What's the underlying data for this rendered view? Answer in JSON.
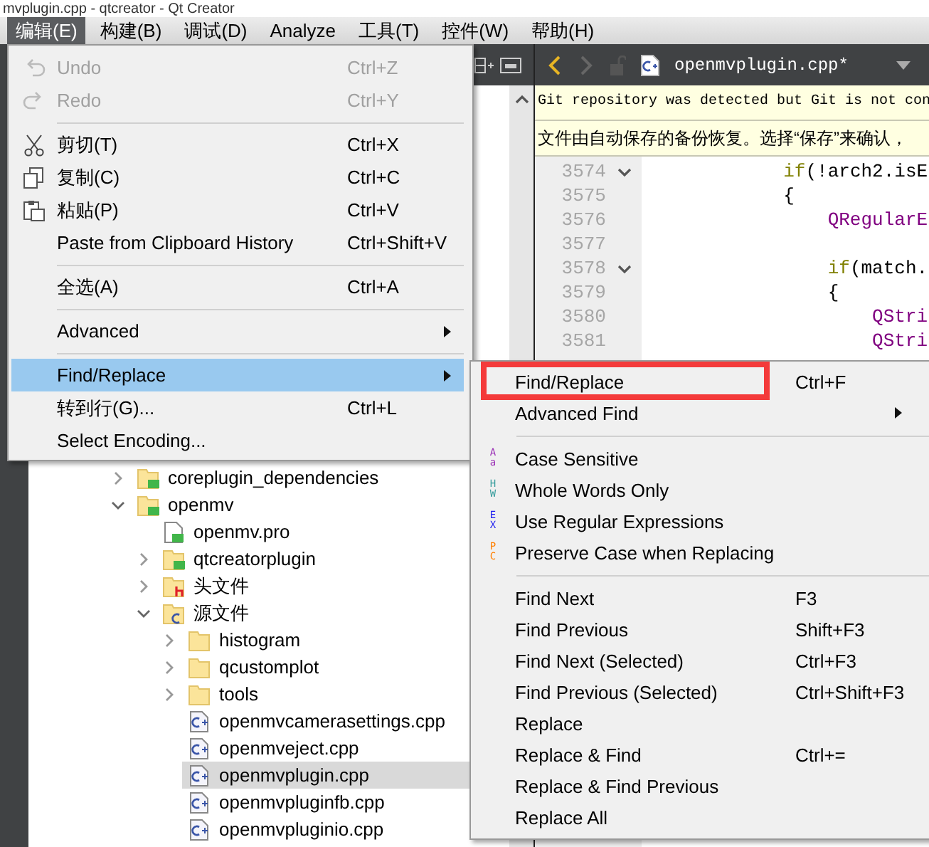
{
  "window": {
    "title": "mvplugin.cpp - qtcreator - Qt Creator"
  },
  "menubar": [
    {
      "label": "编辑(E)",
      "selected": true
    },
    {
      "label": "构建(B)",
      "selected": false
    },
    {
      "label": "调试(D)",
      "selected": false
    },
    {
      "label": "Analyze",
      "selected": false
    },
    {
      "label": "工具(T)",
      "selected": false
    },
    {
      "label": "控件(W)",
      "selected": false
    },
    {
      "label": "帮助(H)",
      "selected": false
    }
  ],
  "project_tree": [
    {
      "label": "coreplugin_dependencies",
      "kind": "qtfolder",
      "expanded": false,
      "selected": false
    },
    {
      "label": "openmv",
      "kind": "qtfolder",
      "expanded": true,
      "selected": false,
      "children": [
        {
          "label": "openmv.pro",
          "kind": "qtfile",
          "selected": false
        },
        {
          "label": "qtcreatorplugin",
          "kind": "qtfolder",
          "expanded": false,
          "selected": false
        },
        {
          "label": "头文件",
          "kind": "headers",
          "expanded": false,
          "selected": false
        },
        {
          "label": "源文件",
          "kind": "sources",
          "expanded": true,
          "selected": false,
          "children": [
            {
              "label": "histogram",
              "kind": "folder",
              "expanded": false,
              "selected": false
            },
            {
              "label": "qcustomplot",
              "kind": "folder",
              "expanded": false,
              "selected": false
            },
            {
              "label": "tools",
              "kind": "folder",
              "expanded": false,
              "selected": false
            },
            {
              "label": "openmvcamerasettings.cpp",
              "kind": "cpp",
              "selected": false
            },
            {
              "label": "openmveject.cpp",
              "kind": "cpp",
              "selected": false
            },
            {
              "label": "openmvplugin.cpp",
              "kind": "cpp",
              "selected": true
            },
            {
              "label": "openmvpluginfb.cpp",
              "kind": "cpp",
              "selected": false
            },
            {
              "label": "openmvpluginio.cpp",
              "kind": "cpp",
              "selected": false
            }
          ]
        }
      ]
    }
  ],
  "editor": {
    "back_enabled": true,
    "forward_enabled": false,
    "file_name": "openmvplugin.cpp*",
    "info_bars": [
      {
        "text": "Git repository was detected but Git is not con",
        "kind": "mono"
      },
      {
        "text": "文件由自动保存的备份恢复。选择“保存”来确认，",
        "kind": "plain"
      }
    ],
    "lines": [
      {
        "number": "3574",
        "fold": true,
        "segments": [
          {
            "text": "            if",
            "kind": "keyword"
          },
          {
            "text": "(!arch2.isE",
            "kind": "plain"
          }
        ]
      },
      {
        "number": "3575",
        "fold": false,
        "segments": [
          {
            "text": "            {",
            "kind": "plain"
          }
        ]
      },
      {
        "number": "3576",
        "fold": false,
        "segments": [
          {
            "text": "                QRegularE",
            "kind": "type"
          }
        ]
      },
      {
        "number": "3577",
        "fold": false
      },
      {
        "number": "3578",
        "fold": true,
        "segments": [
          {
            "text": "                if",
            "kind": "keyword"
          },
          {
            "text": "(match.",
            "kind": "plain"
          }
        ]
      },
      {
        "number": "3579",
        "fold": false,
        "segments": [
          {
            "text": "                {",
            "kind": "plain"
          }
        ]
      },
      {
        "number": "3580",
        "fold": false,
        "segments": [
          {
            "text": "                    QStri",
            "kind": "type"
          }
        ]
      },
      {
        "number": "3581",
        "fold": false,
        "segments": [
          {
            "text": "                    QStri",
            "kind": "type"
          }
        ]
      }
    ]
  },
  "edit_menu": {
    "groups": [
      {
        "items": [
          {
            "label": "Undo",
            "kind": "undo",
            "shortcut": "Ctrl+Z",
            "disabled": true,
            "selected": false,
            "submenu": false
          },
          {
            "label": "Redo",
            "kind": "redo",
            "shortcut": "Ctrl+Y",
            "disabled": true,
            "selected": false,
            "submenu": false
          }
        ]
      },
      {
        "items": [
          {
            "label": "剪切(T)",
            "kind": "cut",
            "shortcut": "Ctrl+X",
            "disabled": false,
            "selected": false,
            "submenu": false
          },
          {
            "label": "复制(C)",
            "kind": "copy",
            "shortcut": "Ctrl+C",
            "disabled": false,
            "selected": false,
            "submenu": false
          },
          {
            "label": "粘贴(P)",
            "kind": "paste",
            "shortcut": "Ctrl+V",
            "disabled": false,
            "selected": false,
            "submenu": false
          },
          {
            "label": "Paste from Clipboard History",
            "shortcut": "Ctrl+Shift+V",
            "disabled": false,
            "selected": false,
            "submenu": false
          }
        ]
      },
      {
        "items": [
          {
            "label": "全选(A)",
            "shortcut": "Ctrl+A",
            "disabled": false,
            "selected": false,
            "submenu": false
          }
        ]
      },
      {
        "items": [
          {
            "label": "Advanced",
            "disabled": false,
            "selected": false,
            "submenu": true
          }
        ]
      },
      {
        "items": [
          {
            "label": "Find/Replace",
            "disabled": false,
            "selected": true,
            "submenu": true
          },
          {
            "label": "转到行(G)...",
            "shortcut": "Ctrl+L",
            "disabled": false,
            "selected": false,
            "submenu": false
          },
          {
            "label": "Select Encoding...",
            "disabled": false,
            "selected": false,
            "submenu": false
          }
        ]
      }
    ]
  },
  "find_submenu": {
    "groups": [
      {
        "items": [
          {
            "label": "Find/Replace",
            "shortcut": "Ctrl+F",
            "framed": true,
            "submenu": false
          },
          {
            "label": "Advanced Find",
            "framed": false,
            "submenu": true
          }
        ]
      },
      {
        "items": [
          {
            "label": "Case Sensitive",
            "framed": false,
            "submenu": false,
            "flag": {
              "top": "A",
              "bottom": "a",
              "color": "#9a2fb5"
            }
          },
          {
            "label": "Whole Words Only",
            "framed": false,
            "submenu": false,
            "flag": {
              "top": "H",
              "bottom": "W",
              "color": "#3a9e9e"
            }
          },
          {
            "label": "Use Regular Expressions",
            "framed": false,
            "submenu": false,
            "flag": {
              "top": "E",
              "bottom": "X",
              "color": "#1c1cf0"
            }
          },
          {
            "label": "Preserve Case when Replacing",
            "framed": false,
            "submenu": false,
            "flag": {
              "top": "P",
              "bottom": "C",
              "color": "#ff7f00"
            }
          }
        ]
      },
      {
        "items": [
          {
            "label": "Find Next",
            "shortcut": "F3",
            "framed": false,
            "submenu": false
          },
          {
            "label": "Find Previous",
            "shortcut": "Shift+F3",
            "framed": false,
            "submenu": false
          },
          {
            "label": "Find Next (Selected)",
            "shortcut": "Ctrl+F3",
            "framed": false,
            "submenu": false
          },
          {
            "label": "Find Previous (Selected)",
            "shortcut": "Ctrl+Shift+F3",
            "framed": false,
            "submenu": false
          },
          {
            "label": "Replace",
            "framed": false,
            "submenu": false
          },
          {
            "label": "Replace & Find",
            "shortcut": "Ctrl+=",
            "framed": false,
            "submenu": false
          },
          {
            "label": "Replace & Find Previous",
            "framed": false,
            "submenu": false
          },
          {
            "label": "Replace All",
            "framed": false,
            "submenu": false
          }
        ]
      }
    ]
  }
}
